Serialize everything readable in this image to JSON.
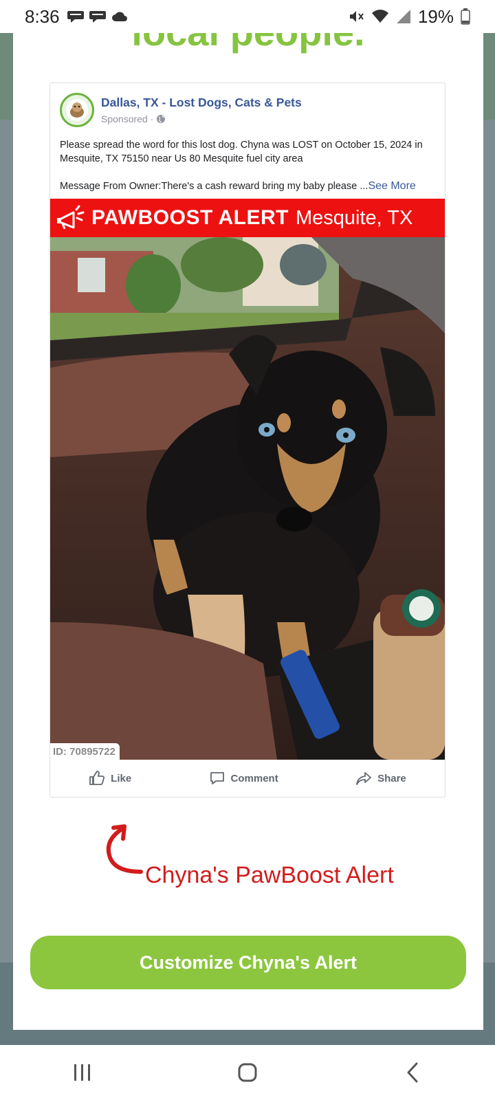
{
  "status_bar": {
    "time": "8:36",
    "battery_percent": "19%",
    "left_icons": [
      "chat-bubble-icon",
      "chat-bubble-icon",
      "cloud-icon"
    ],
    "right_icons": [
      "mute-icon",
      "wifi-icon",
      "signal-icon",
      "battery-icon"
    ]
  },
  "modal": {
    "heading": "local people."
  },
  "post": {
    "page_name": "Dallas, TX - Lost Dogs, Cats & Pets",
    "sponsored": "Sponsored ·",
    "text_line1": "Please spread the word for this lost dog. Chyna was LOST on October 15, 2024 in Mesquite, TX 75150 near Us 80 Mesquite fuel city area",
    "text_line2": "Message From Owner:There's a cash reward bring my baby please ...",
    "see_more": "See More",
    "alert_title": "PAWBOOST ALERT",
    "alert_location": "Mesquite, TX",
    "photo_id": "ID: 70895722",
    "actions": {
      "like": "Like",
      "comment": "Comment",
      "share": "Share"
    }
  },
  "caption": "Chyna's PawBoost Alert",
  "cta": {
    "label": "Customize Chyna's Alert"
  },
  "colors": {
    "brand_green": "#8cc63f",
    "alert_red": "#ee1111",
    "caption_red": "#d21c1c",
    "facebook_link": "#385898"
  }
}
